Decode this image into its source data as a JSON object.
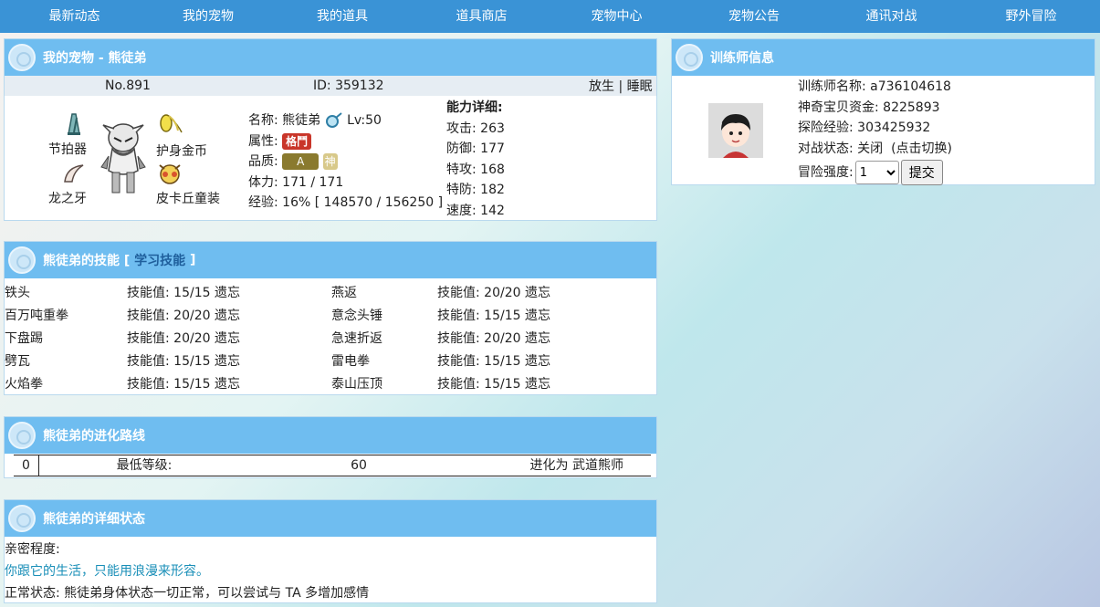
{
  "nav": {
    "items": [
      "最新动态",
      "我的宠物",
      "我的道具",
      "道具商店",
      "宠物中心",
      "宠物公告",
      "通讯对战",
      "野外冒险"
    ]
  },
  "pet_panel": {
    "title": "我的宠物 - 熊徒弟",
    "number": "No.891",
    "id_text": "ID: 359132",
    "release": "放生",
    "separator": "|",
    "sleep": "睡眠",
    "items": {
      "metronome": "节拍器",
      "amulet_coin": "护身金币",
      "dragon_fang": "龙之牙",
      "pikachu_costume": "皮卡丘童装"
    },
    "name_label": "名称:",
    "name_value": "熊徒弟",
    "level": "Lv:50",
    "attr_label": "属性:",
    "attr_badge": "格鬥",
    "quality_label": "品质:",
    "quality_badge": "A",
    "quality_extra": "神",
    "hp_label": "体力:",
    "hp_value": "171 / 171",
    "exp_label": "经验:",
    "exp_value": "16% [ 148570 / 156250 ]",
    "stats_title": "能力详细:",
    "stats": [
      {
        "label": "攻击:",
        "value": "263"
      },
      {
        "label": "防御:",
        "value": "177"
      },
      {
        "label": "特攻:",
        "value": "168"
      },
      {
        "label": "特防:",
        "value": "182"
      },
      {
        "label": "速度:",
        "value": "142"
      }
    ],
    "colors": {
      "attr_badge": "#c9362a",
      "quality_badge": "#8a7a2e",
      "quality_extra": "#d8c98a"
    }
  },
  "skills_panel": {
    "title_prefix": "熊徒弟的技能 [",
    "learn_link": "学习技能",
    "title_suffix": "]",
    "skills": [
      {
        "name": "铁头",
        "value": "技能值: 15/15",
        "forget": "遗忘"
      },
      {
        "name": "燕返",
        "value": "技能值: 20/20",
        "forget": "遗忘"
      },
      {
        "name": "百万吨重拳",
        "value": "技能值: 20/20",
        "forget": "遗忘"
      },
      {
        "name": "意念头锤",
        "value": "技能值: 15/15",
        "forget": "遗忘"
      },
      {
        "name": "下盘踢",
        "value": "技能值: 20/20",
        "forget": "遗忘"
      },
      {
        "name": "急速折返",
        "value": "技能值: 20/20",
        "forget": "遗忘"
      },
      {
        "name": "劈瓦",
        "value": "技能值: 15/15",
        "forget": "遗忘"
      },
      {
        "name": "雷电拳",
        "value": "技能值: 15/15",
        "forget": "遗忘"
      },
      {
        "name": "火焰拳",
        "value": "技能值: 15/15",
        "forget": "遗忘"
      },
      {
        "name": "泰山压顶",
        "value": "技能值: 15/15",
        "forget": "遗忘"
      }
    ]
  },
  "evolution_panel": {
    "title": "熊徒弟的进化路线",
    "row": {
      "index": "0",
      "min_level_label": "最低等级:",
      "level": "60",
      "evolve_to": "进化为 武道熊师"
    }
  },
  "status_panel": {
    "title": "熊徒弟的详细状态",
    "intimacy_label": "亲密程度:",
    "intimacy_text": "你跟它的生活，只能用浪漫来形容。",
    "normal_status": "正常状态: 熊徒弟身体状态一切正常，可以尝试与 TA 多增加感情",
    "intimacy_color": "#1a8fb8"
  },
  "trainer_panel": {
    "title": "训练师信息",
    "name_label": "训练师名称:",
    "name_value": "a736104618",
    "money_label": "神奇宝贝资金:",
    "money_value": "8225893",
    "exp_label": "探险经验:",
    "exp_value": "303425932",
    "battle_label": "对战状态:",
    "battle_value": "关闭",
    "battle_toggle": "(点击切换)",
    "difficulty_label": "冒险强度:",
    "difficulty_value": "1",
    "submit": "提交"
  }
}
